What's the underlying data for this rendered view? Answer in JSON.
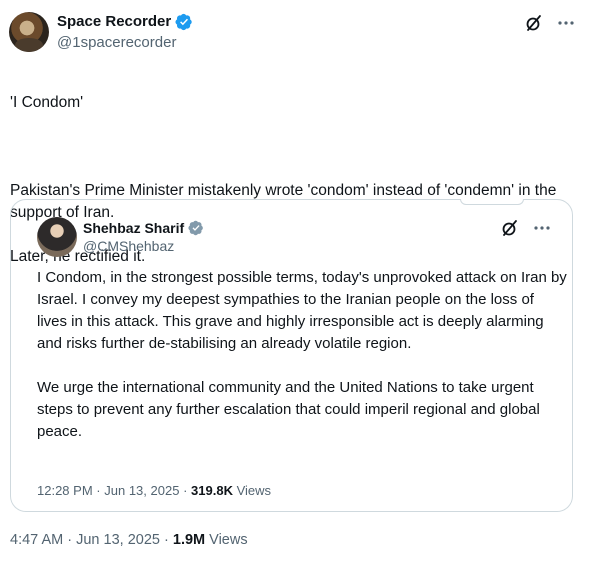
{
  "author": {
    "name": "Space Recorder",
    "handle": "@1spacerecorder"
  },
  "post": {
    "line1": "'I Condom'",
    "line2": "Pakistan's Prime Minister mistakenly wrote 'condom' instead of 'condemn' in the support of Iran.",
    "line3": "Later, he rectified it.",
    "time": "4:47 AM",
    "sep1": "·",
    "date": "Jun 13, 2025",
    "sep2": "·",
    "views_count": "1.9M",
    "views_label": "Views"
  },
  "quote": {
    "name": "Shehbaz Sharif",
    "handle": "@CMShehbaz",
    "para1": "I Condom, in the strongest possible terms, today's unprovoked attack on Iran by Israel. I convey my deepest sympathies to the Iranian people on the loss of lives in this attack. This grave and highly irresponsible act is deeply alarming and risks further de-stabilising an already volatile region.",
    "para2": "We urge the international community and the United Nations to take urgent steps to prevent any further escalation that could imperil regional and global peace.",
    "time": "12:28 PM",
    "sep1": "·",
    "date": "Jun 13, 2025",
    "sep2": "·",
    "views_count": "319.8K",
    "views_label": "Views"
  },
  "icons": {
    "verified": "verified-badge-icon",
    "grok": "grok-icon",
    "more": "more-icon"
  },
  "colors": {
    "verified_blue": "#1d9bf0",
    "text": "#0f1419",
    "muted": "#536471",
    "border": "#cfd9de"
  }
}
